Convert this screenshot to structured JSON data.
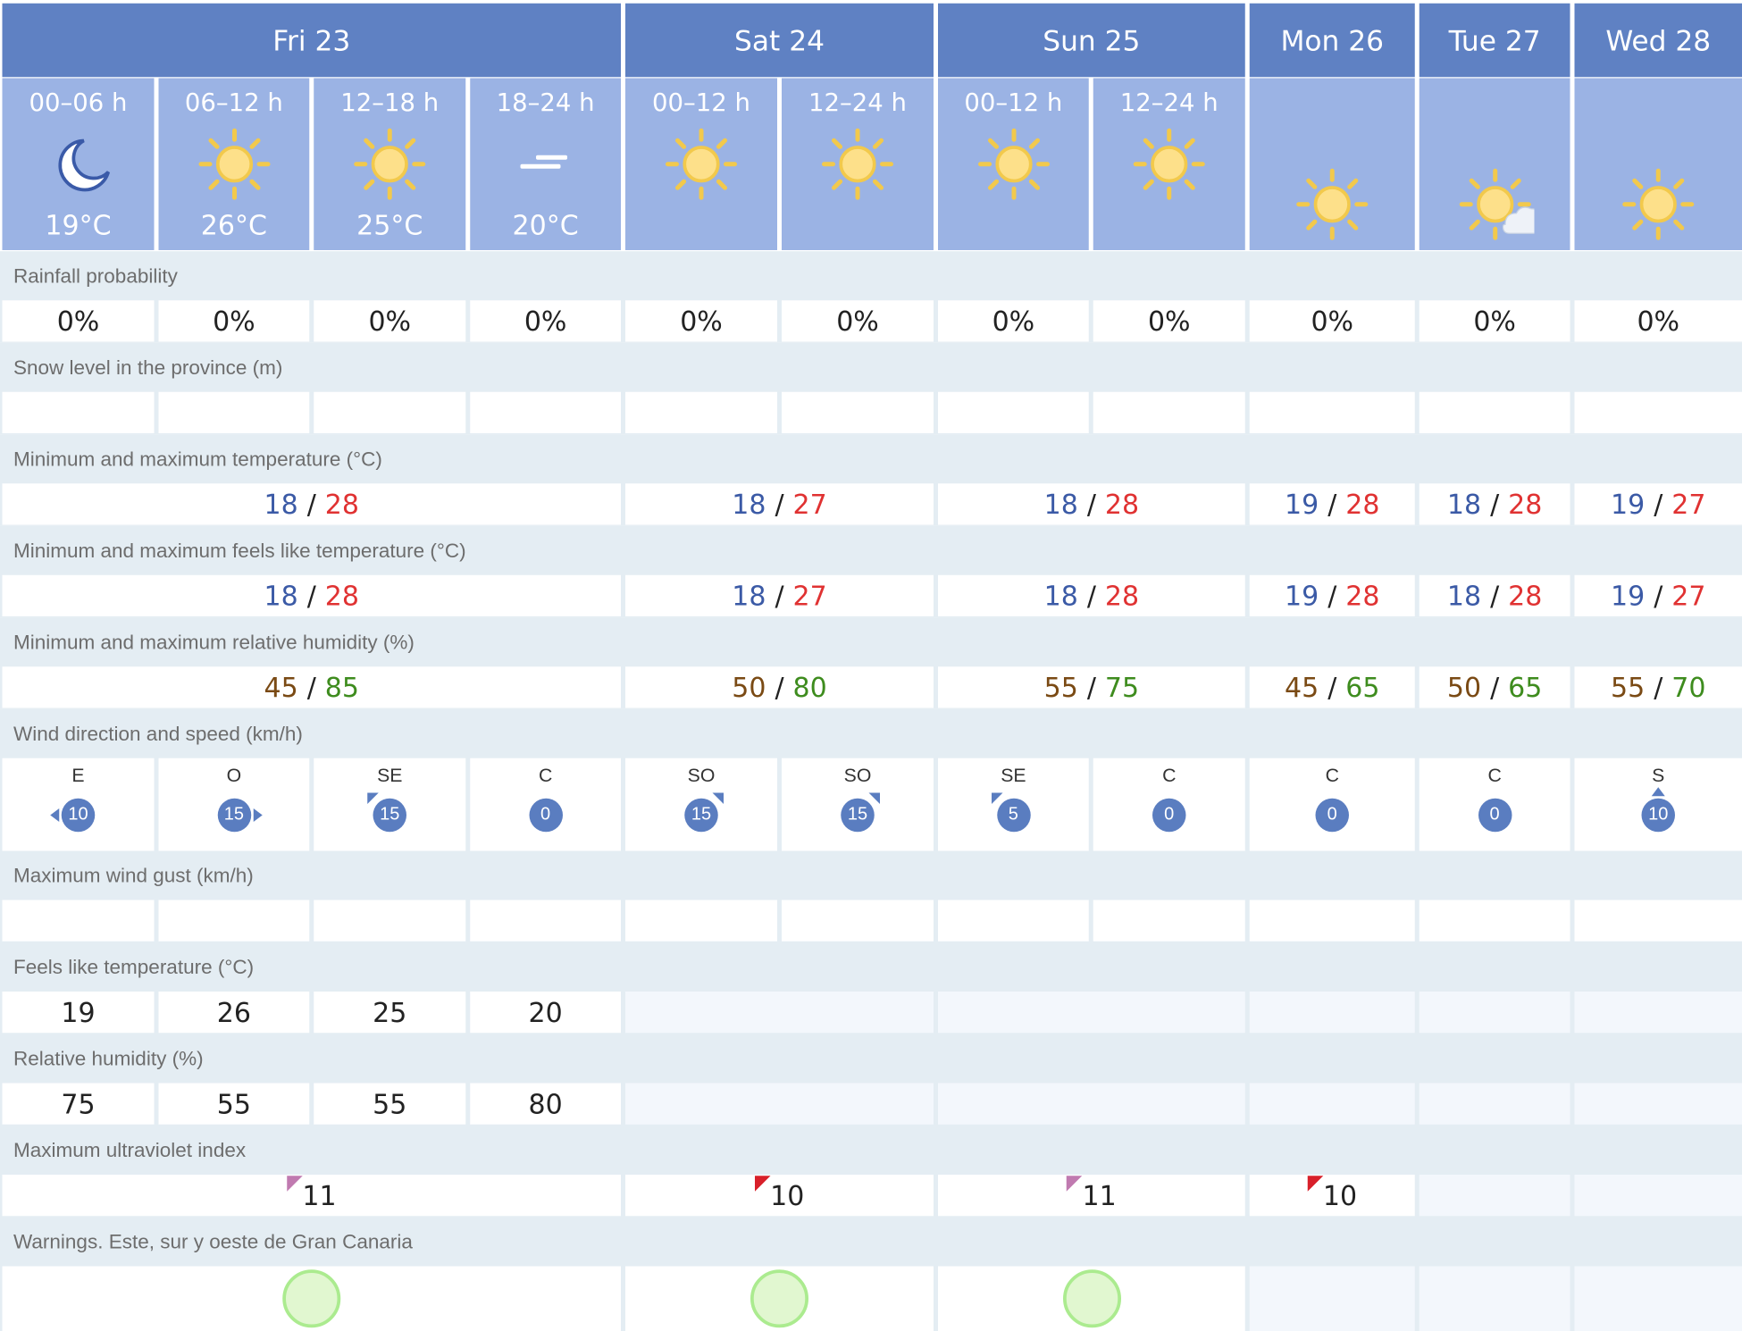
{
  "days": [
    {
      "label": "Fri 23",
      "cols": 4
    },
    {
      "label": "Sat 24",
      "cols": 2
    },
    {
      "label": "Sun 25",
      "cols": 2
    },
    {
      "label": "Mon 26",
      "cols": 1
    },
    {
      "label": "Tue 27",
      "cols": 1
    },
    {
      "label": "Wed 28",
      "cols": 1
    }
  ],
  "periods": [
    {
      "label": "00–06 h",
      "icon": "moon-icon",
      "temp": "19°C"
    },
    {
      "label": "06–12 h",
      "icon": "sun-icon",
      "temp": "26°C"
    },
    {
      "label": "12–18 h",
      "icon": "sun-icon",
      "temp": "25°C"
    },
    {
      "label": "18–24 h",
      "icon": "haze-icon",
      "temp": "20°C"
    },
    {
      "label": "00–12 h",
      "icon": "sun-icon",
      "temp": ""
    },
    {
      "label": "12–24 h",
      "icon": "sun-icon",
      "temp": ""
    },
    {
      "label": "00–12 h",
      "icon": "sun-icon",
      "temp": ""
    },
    {
      "label": "12–24 h",
      "icon": "sun-icon",
      "temp": ""
    },
    {
      "label": "",
      "icon": "sun-icon",
      "temp": ""
    },
    {
      "label": "",
      "icon": "sun-cloud-icon",
      "temp": ""
    },
    {
      "label": "",
      "icon": "sun-icon",
      "temp": ""
    }
  ],
  "labels": {
    "rain": "Rainfall probability",
    "snow": "Snow level in the province (m)",
    "temp": "Minimum and maximum temperature (°C)",
    "feels_minmax": "Minimum and maximum feels like temperature (°C)",
    "humidity_minmax": "Minimum and maximum relative humidity (%)",
    "wind": "Wind direction and speed (km/h)",
    "gust": "Maximum wind gust (km/h)",
    "feels": "Feels like temperature (°C)",
    "humidity": "Relative humidity (%)",
    "uv": "Maximum ultraviolet index",
    "warnings": "Warnings. Este, sur y oeste de Gran Canaria"
  },
  "rain": [
    "0%",
    "0%",
    "0%",
    "0%",
    "0%",
    "0%",
    "0%",
    "0%",
    "0%",
    "0%",
    "0%"
  ],
  "temp_minmax": [
    {
      "min": "18",
      "max": "28"
    },
    {
      "min": "18",
      "max": "27"
    },
    {
      "min": "18",
      "max": "28"
    },
    {
      "min": "19",
      "max": "28"
    },
    {
      "min": "18",
      "max": "28"
    },
    {
      "min": "19",
      "max": "27"
    }
  ],
  "feels_minmax": [
    {
      "min": "18",
      "max": "28"
    },
    {
      "min": "18",
      "max": "27"
    },
    {
      "min": "18",
      "max": "28"
    },
    {
      "min": "19",
      "max": "28"
    },
    {
      "min": "18",
      "max": "28"
    },
    {
      "min": "19",
      "max": "27"
    }
  ],
  "humidity_minmax": [
    {
      "min": "45",
      "max": "85"
    },
    {
      "min": "50",
      "max": "80"
    },
    {
      "min": "55",
      "max": "75"
    },
    {
      "min": "45",
      "max": "65"
    },
    {
      "min": "50",
      "max": "65"
    },
    {
      "min": "55",
      "max": "70"
    }
  ],
  "wind": [
    {
      "dir": "E",
      "speed": "10"
    },
    {
      "dir": "O",
      "speed": "15"
    },
    {
      "dir": "SE",
      "speed": "15"
    },
    {
      "dir": "C",
      "speed": "0"
    },
    {
      "dir": "SO",
      "speed": "15"
    },
    {
      "dir": "SO",
      "speed": "15"
    },
    {
      "dir": "SE",
      "speed": "5"
    },
    {
      "dir": "C",
      "speed": "0"
    },
    {
      "dir": "C",
      "speed": "0"
    },
    {
      "dir": "C",
      "speed": "0"
    },
    {
      "dir": "S",
      "speed": "10"
    }
  ],
  "feels": [
    "19",
    "26",
    "25",
    "20"
  ],
  "humidity": [
    "75",
    "55",
    "55",
    "80"
  ],
  "uv": [
    {
      "value": "11",
      "color": "#c07ab0"
    },
    {
      "value": "10",
      "color": "#d8202a"
    },
    {
      "value": "11",
      "color": "#c07ab0"
    },
    {
      "value": "10",
      "color": "#d8202a"
    }
  ],
  "warnings_count": 3,
  "colors": {
    "day_header": "#5f81c3",
    "period_header": "#9bb3e4",
    "band": "#e4edf3",
    "min_temp": "#3b5aa6",
    "max_temp": "#e03232",
    "humidity_min": "#7a4a14",
    "humidity_max": "#3e8c1e",
    "wind_circle": "#5a7dc0",
    "warning_fill": "#e1f7d0",
    "warning_border": "#abeb8f"
  }
}
